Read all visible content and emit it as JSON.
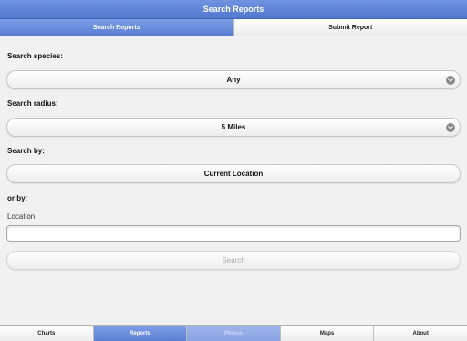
{
  "header": {
    "title": "Search Reports"
  },
  "segments": [
    {
      "label": "Search Reports",
      "active": true
    },
    {
      "label": "Submit Report",
      "active": false
    }
  ],
  "form": {
    "species_label": "Search species:",
    "species_value": "Any",
    "radius_label": "Search radius:",
    "radius_value": "5 Miles",
    "search_by_label": "Search by:",
    "current_location_button": "Current Location",
    "or_by_label": "or by:",
    "location_label": "Location:",
    "location_value": "",
    "location_placeholder": "",
    "search_button": "Search"
  },
  "tabs": [
    {
      "label": "Charts",
      "state": "normal"
    },
    {
      "label": "Reports",
      "state": "active"
    },
    {
      "label": "Photos",
      "state": "dim"
    },
    {
      "label": "Maps",
      "state": "normal"
    },
    {
      "label": "About",
      "state": "normal"
    }
  ],
  "colors": {
    "accent": "#5a7fd3",
    "title_bar": "#5f86d8",
    "background": "#f1f1f1"
  },
  "icons": {
    "select_chevron": "chevron-down-circle-icon"
  }
}
